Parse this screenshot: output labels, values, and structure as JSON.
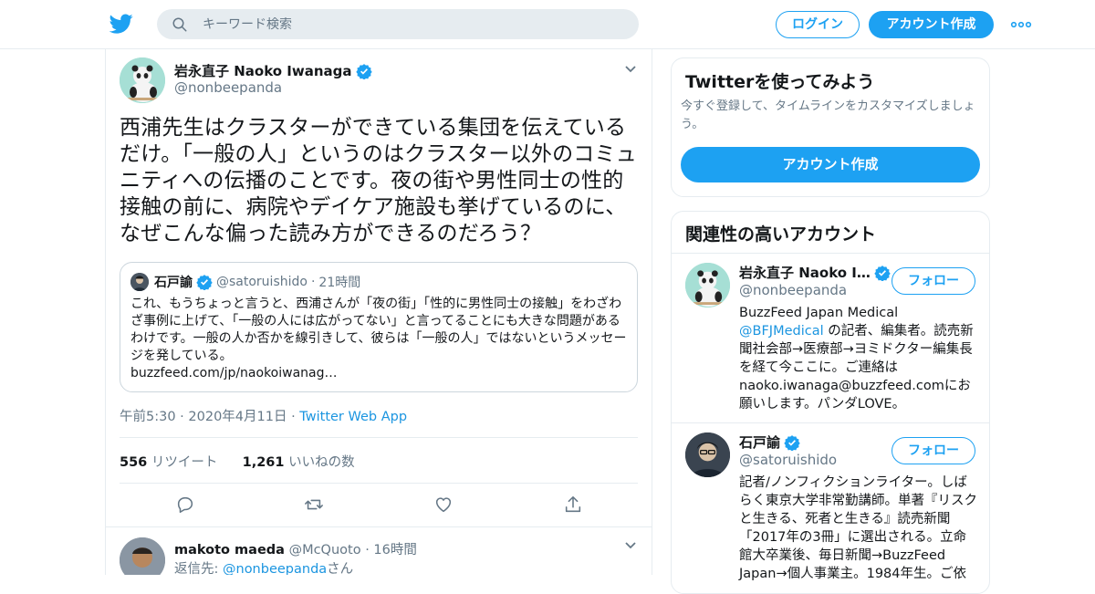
{
  "header": {
    "search_placeholder": "キーワード検索",
    "login_label": "ログイン",
    "signup_label": "アカウント作成",
    "brand_color": "#1da1f2"
  },
  "tweet": {
    "author_name": "岩永直子 Naoko Iwanaga",
    "author_handle": "@nonbeepanda",
    "text": "西浦先生はクラスターができている集団を伝えているだけ。「一般の人」というのはクラスター以外のコミュニティへの伝播のことです。夜の街や男性同士の性的接触の前に、病院やデイケア施設も挙げているのに、なぜこんな偏った読み方ができるのだろう？",
    "quote": {
      "author_name": "石戸諭",
      "author_handle": "@satoruishido",
      "separator": "·",
      "time": "21時間",
      "text": "これ、もうちょっと言うと、西浦さんが「夜の街」「性的に男性同士の接触」をわざわざ事例に上げて、「一般の人には広がってない」と言ってることにも大きな問題があるわけです。一般の人か否かを線引きして、彼らは「一般の人」ではないというメッセージを発している。",
      "link": "buzzfeed.com/jp/naokoiwanag…"
    },
    "timestamp": "午前5:30 · 2020年4月11日",
    "meta_separator": "·",
    "source": "Twitter Web App",
    "retweets_count": "556",
    "retweets_label": "リツイート",
    "likes_count": "1,261",
    "likes_label": "いいねの数"
  },
  "reply": {
    "author_name": "makoto maeda",
    "author_handle": "@McQuoto",
    "separator": "·",
    "time": "16時間",
    "reply_prefix": "返信先: ",
    "reply_to": "@nonbeepanda",
    "reply_suffix": "さん"
  },
  "sidebar": {
    "signup_card": {
      "title": "Twitterを使ってみよう",
      "description": "今すぐ登録して、タイムラインをカスタマイズしましょう。",
      "button_label": "アカウント作成"
    },
    "related_title": "関連性の高いアカウント",
    "accounts": [
      {
        "name": "岩永直子 Naoko I…",
        "handle": "@nonbeepanda",
        "follow_label": "フォロー",
        "bio_1": "BuzzFeed Japan Medical ",
        "bio_link": "@BFJMedical",
        "bio_2": " の記者、編集者。読売新聞社会部→医療部→ヨミドクター編集長を経て今ここに。ご連絡はnaoko.iwanaga@buzzfeed.comにお願いします。パンダLOVE。"
      },
      {
        "name": "石戸諭",
        "handle": "@satoruishido",
        "follow_label": "フォロー",
        "bio": "記者/ノンフィクションライター。しばらく東京大学非常勤講師。単著『リスクと生きる、死者と生きる』読売新聞「2017年の3冊」に選出される。立命館大卒業後、毎日新聞→BuzzFeed Japan→個人事業主。1984年生。ご依"
      }
    ]
  }
}
